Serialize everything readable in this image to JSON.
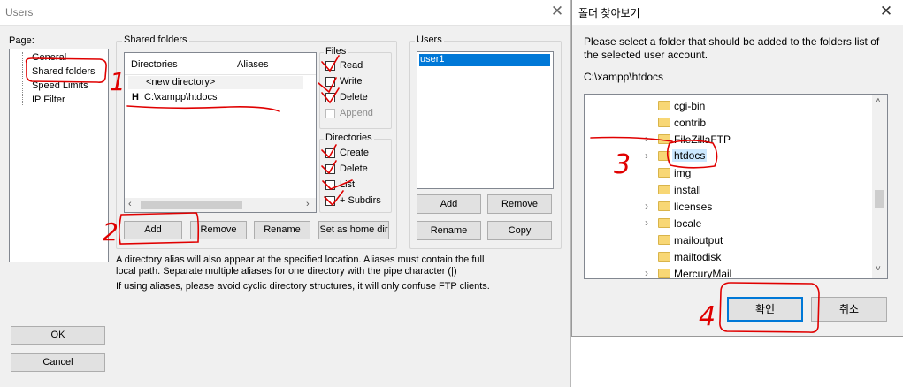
{
  "users_window": {
    "title": "Users",
    "page_label": "Page:",
    "pages": [
      "General",
      "Shared folders",
      "Speed Limits",
      "IP Filter"
    ],
    "shared_folders": {
      "group_title": "Shared folders",
      "col_directories": "Directories",
      "col_aliases": "Aliases",
      "new_directory": "<new directory>",
      "home_prefix": "H",
      "directory_path": "C:\\xampp\\htdocs",
      "btn_add": "Add",
      "btn_remove": "Remove",
      "btn_rename": "Rename",
      "btn_set_home": "Set as home dir"
    },
    "files": {
      "title": "Files",
      "read": "Read",
      "write": "Write",
      "delete": "Delete",
      "append": "Append"
    },
    "directories": {
      "title": "Directories",
      "create": "Create",
      "delete": "Delete",
      "list": "List",
      "subdirs": "+ Subdirs"
    },
    "users": {
      "title": "Users",
      "items": [
        "user1"
      ],
      "btn_add": "Add",
      "btn_remove": "Remove",
      "btn_rename": "Rename",
      "btn_copy": "Copy"
    },
    "help_text_1": "A directory alias will also appear at the specified location. Aliases must contain the full local path. Separate multiple aliases for one directory with the pipe character (|)",
    "help_text_2": "If using aliases, please avoid cyclic directory structures, it will only confuse FTP clients.",
    "btn_ok": "OK",
    "btn_cancel": "Cancel"
  },
  "folder_dialog": {
    "title": "폴더 찾아보기",
    "description": "Please select a folder that should be added to the folders list of the selected user account.",
    "current_path": "C:\\xampp\\htdocs",
    "folders": [
      {
        "name": "cgi-bin",
        "expandable": false
      },
      {
        "name": "contrib",
        "expandable": false
      },
      {
        "name": "FileZillaFTP",
        "expandable": true
      },
      {
        "name": "htdocs",
        "expandable": true,
        "selected": true
      },
      {
        "name": "img",
        "expandable": false
      },
      {
        "name": "install",
        "expandable": false
      },
      {
        "name": "licenses",
        "expandable": true
      },
      {
        "name": "locale",
        "expandable": true
      },
      {
        "name": "mailoutput",
        "expandable": false
      },
      {
        "name": "mailtodisk",
        "expandable": false
      },
      {
        "name": "MercuryMail",
        "expandable": true
      }
    ],
    "btn_ok": "확인",
    "btn_cancel": "취소"
  },
  "annotations": [
    "1",
    "2",
    "3",
    "4"
  ],
  "colors": {
    "annotation": "#e00000",
    "selection": "#0078d7",
    "window_bg": "#f0f0f0"
  }
}
